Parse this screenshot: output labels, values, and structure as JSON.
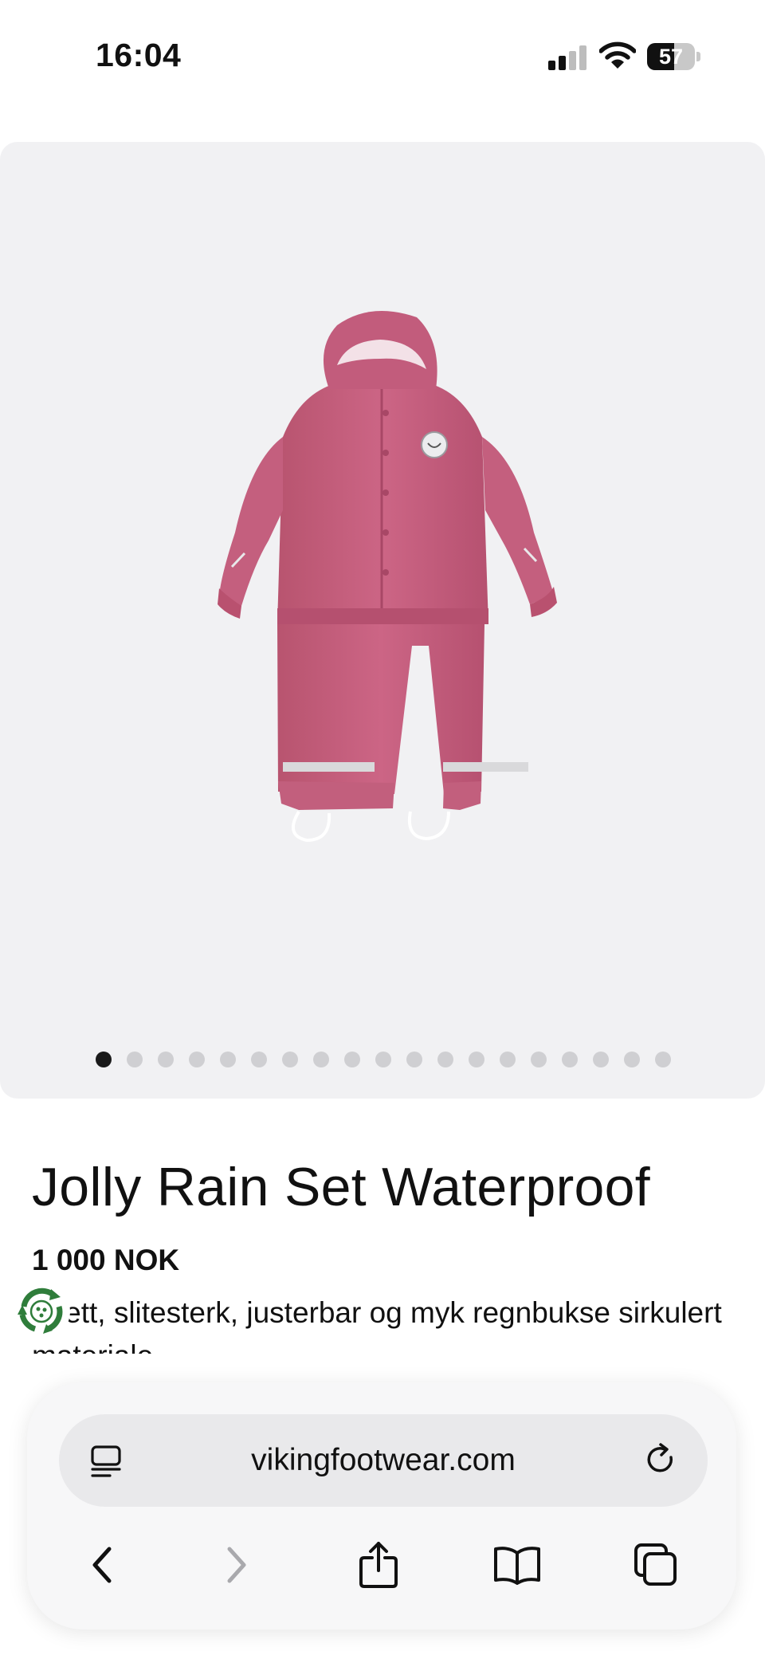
{
  "status_bar": {
    "time": "16:04",
    "battery_percent": "57",
    "battery_level": 0.57,
    "signal_bars_active": 2,
    "signal_bars_total": 4
  },
  "gallery": {
    "image_description": "Pink children's rain jacket and rain pants set",
    "dots_total": 19,
    "active_index": 0
  },
  "product": {
    "title": "Jolly Rain Set Waterproof",
    "price": "1 000 NOK",
    "description": "ıntett, slitesterk, justerbar og myk regnbukse sirkulert materiale"
  },
  "icons": {
    "eco_badge": "recycle-badge-icon",
    "reader": "reader-mode-icon",
    "reload": "reload-icon",
    "back": "chevron-left-icon",
    "forward": "chevron-right-icon",
    "share": "share-icon",
    "bookmarks": "book-icon",
    "tabs": "tabs-icon"
  },
  "browser": {
    "url": "vikingfootwear.com"
  },
  "colors": {
    "product_pink": "#c9607f",
    "gallery_bg": "#f1f1f3",
    "eco_green": "#2f7d3b"
  }
}
